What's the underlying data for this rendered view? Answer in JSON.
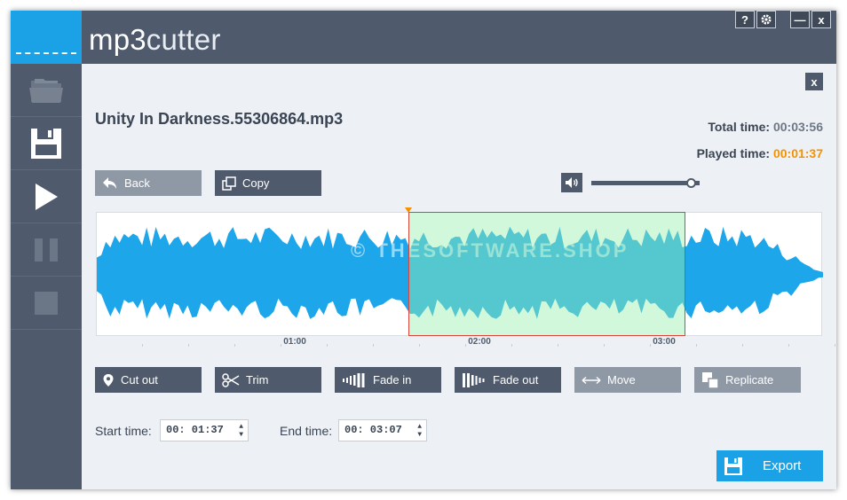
{
  "app": {
    "title_strong": "mp3",
    "title_thin": "cutter",
    "help_label": "?",
    "minimize_label": "—",
    "close_label": "x"
  },
  "sidebar": {
    "items": [
      {
        "name": "open-folder",
        "icon": "folder-icon"
      },
      {
        "name": "save",
        "icon": "save-icon"
      },
      {
        "name": "play",
        "icon": "play-icon"
      },
      {
        "name": "pause",
        "icon": "pause-icon"
      },
      {
        "name": "stop",
        "icon": "stop-icon"
      }
    ]
  },
  "file": {
    "name": "Unity In Darkness.55306864.mp3",
    "close_label": "x"
  },
  "times": {
    "total_label": "Total time:",
    "total_value": "00:03:56",
    "played_label": "Played time:",
    "played_value": "00:01:37"
  },
  "toolbar": {
    "back_label": "Back",
    "copy_label": "Copy"
  },
  "volume": {
    "level": 0.93
  },
  "waveform": {
    "watermark": "© THESOFTWARE.SHOP",
    "ruler_labels": [
      "01:00",
      "02:00",
      "03:00"
    ],
    "selection_start_seconds": 97,
    "selection_end_seconds": 187,
    "duration_seconds": 236
  },
  "actions": {
    "cut_out": "Cut out",
    "trim": "Trim",
    "fade_in": "Fade in",
    "fade_out": "Fade out",
    "move": "Move",
    "replicate": "Replicate"
  },
  "range": {
    "start_label": "Start time:",
    "start_value": "00: 01:37",
    "end_label": "End time:",
    "end_value": "00: 03:07"
  },
  "export": {
    "label": "Export"
  },
  "colors": {
    "accent": "#1ba2e6",
    "sidebar": "#4f5b6c",
    "played": "#f39200",
    "selection": "#98f0b0",
    "selection_border": "#d9443a"
  }
}
